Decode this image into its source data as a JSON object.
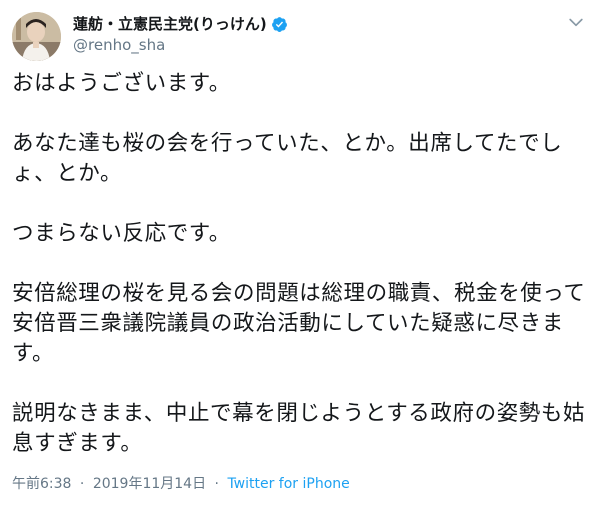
{
  "tweet": {
    "author": {
      "display_name": "蓮舫・立憲民主党(りっけん)",
      "handle": "@renho_sha",
      "verified": true,
      "avatar_icon": "profile-photo"
    },
    "menu_icon": "chevron-down-icon",
    "paragraphs": [
      "おはようございます。",
      "あなた達も桜の会を行っていた、とか。出席してたでしょ、とか。",
      "つまらない反応です。",
      "安倍総理の桜を見る会の問題は総理の職責、税金を使って安倍晋三衆議院議員の政治活動にしていた疑惑に尽きます。",
      "説明なきまま、中止で幕を閉じようとする政府の姿勢も姑息すぎます。"
    ],
    "time": "午前6:38",
    "separator": "·",
    "date": "2019年11月14日",
    "source": "Twitter for iPhone"
  },
  "colors": {
    "text": "#14171a",
    "secondary": "#657786",
    "link": "#1da1f2",
    "verified_badge": "#1da1f2"
  }
}
